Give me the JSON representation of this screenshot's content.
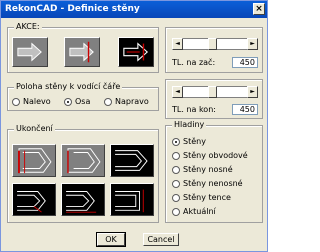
{
  "window": {
    "title": "RekonCAD - Definice stěny",
    "close_label": "×"
  },
  "akce": {
    "label": "AKCE:"
  },
  "tl_zac": {
    "label": "TL. na zač:",
    "value": "450",
    "slider_fraction": 0.45
  },
  "tl_kon": {
    "label": "TL. na kon:",
    "value": "450",
    "slider_fraction": 0.45
  },
  "poloha": {
    "label": "Poloha stěny k vodící čáře",
    "options": [
      "Nalevo",
      "Osa",
      "Napravo"
    ],
    "selected": "Osa"
  },
  "ukonceni": {
    "label": "Ukončení"
  },
  "hladiny": {
    "label": "Hladiny",
    "options": [
      "Stěny",
      "Stěny obvodové",
      "Stěny nosné",
      "Stěny nenosné",
      "Stěny tence",
      "Aktuální"
    ],
    "selected": "Stěny"
  },
  "buttons": {
    "ok": "OK",
    "cancel": "Cancel"
  },
  "slider": {
    "left_arrow": "◄",
    "right_arrow": "►"
  },
  "colors": {
    "titlebar": "#0a5fd8",
    "dialog_bg": "#ece9d8",
    "accent_red": "#cc0000"
  }
}
